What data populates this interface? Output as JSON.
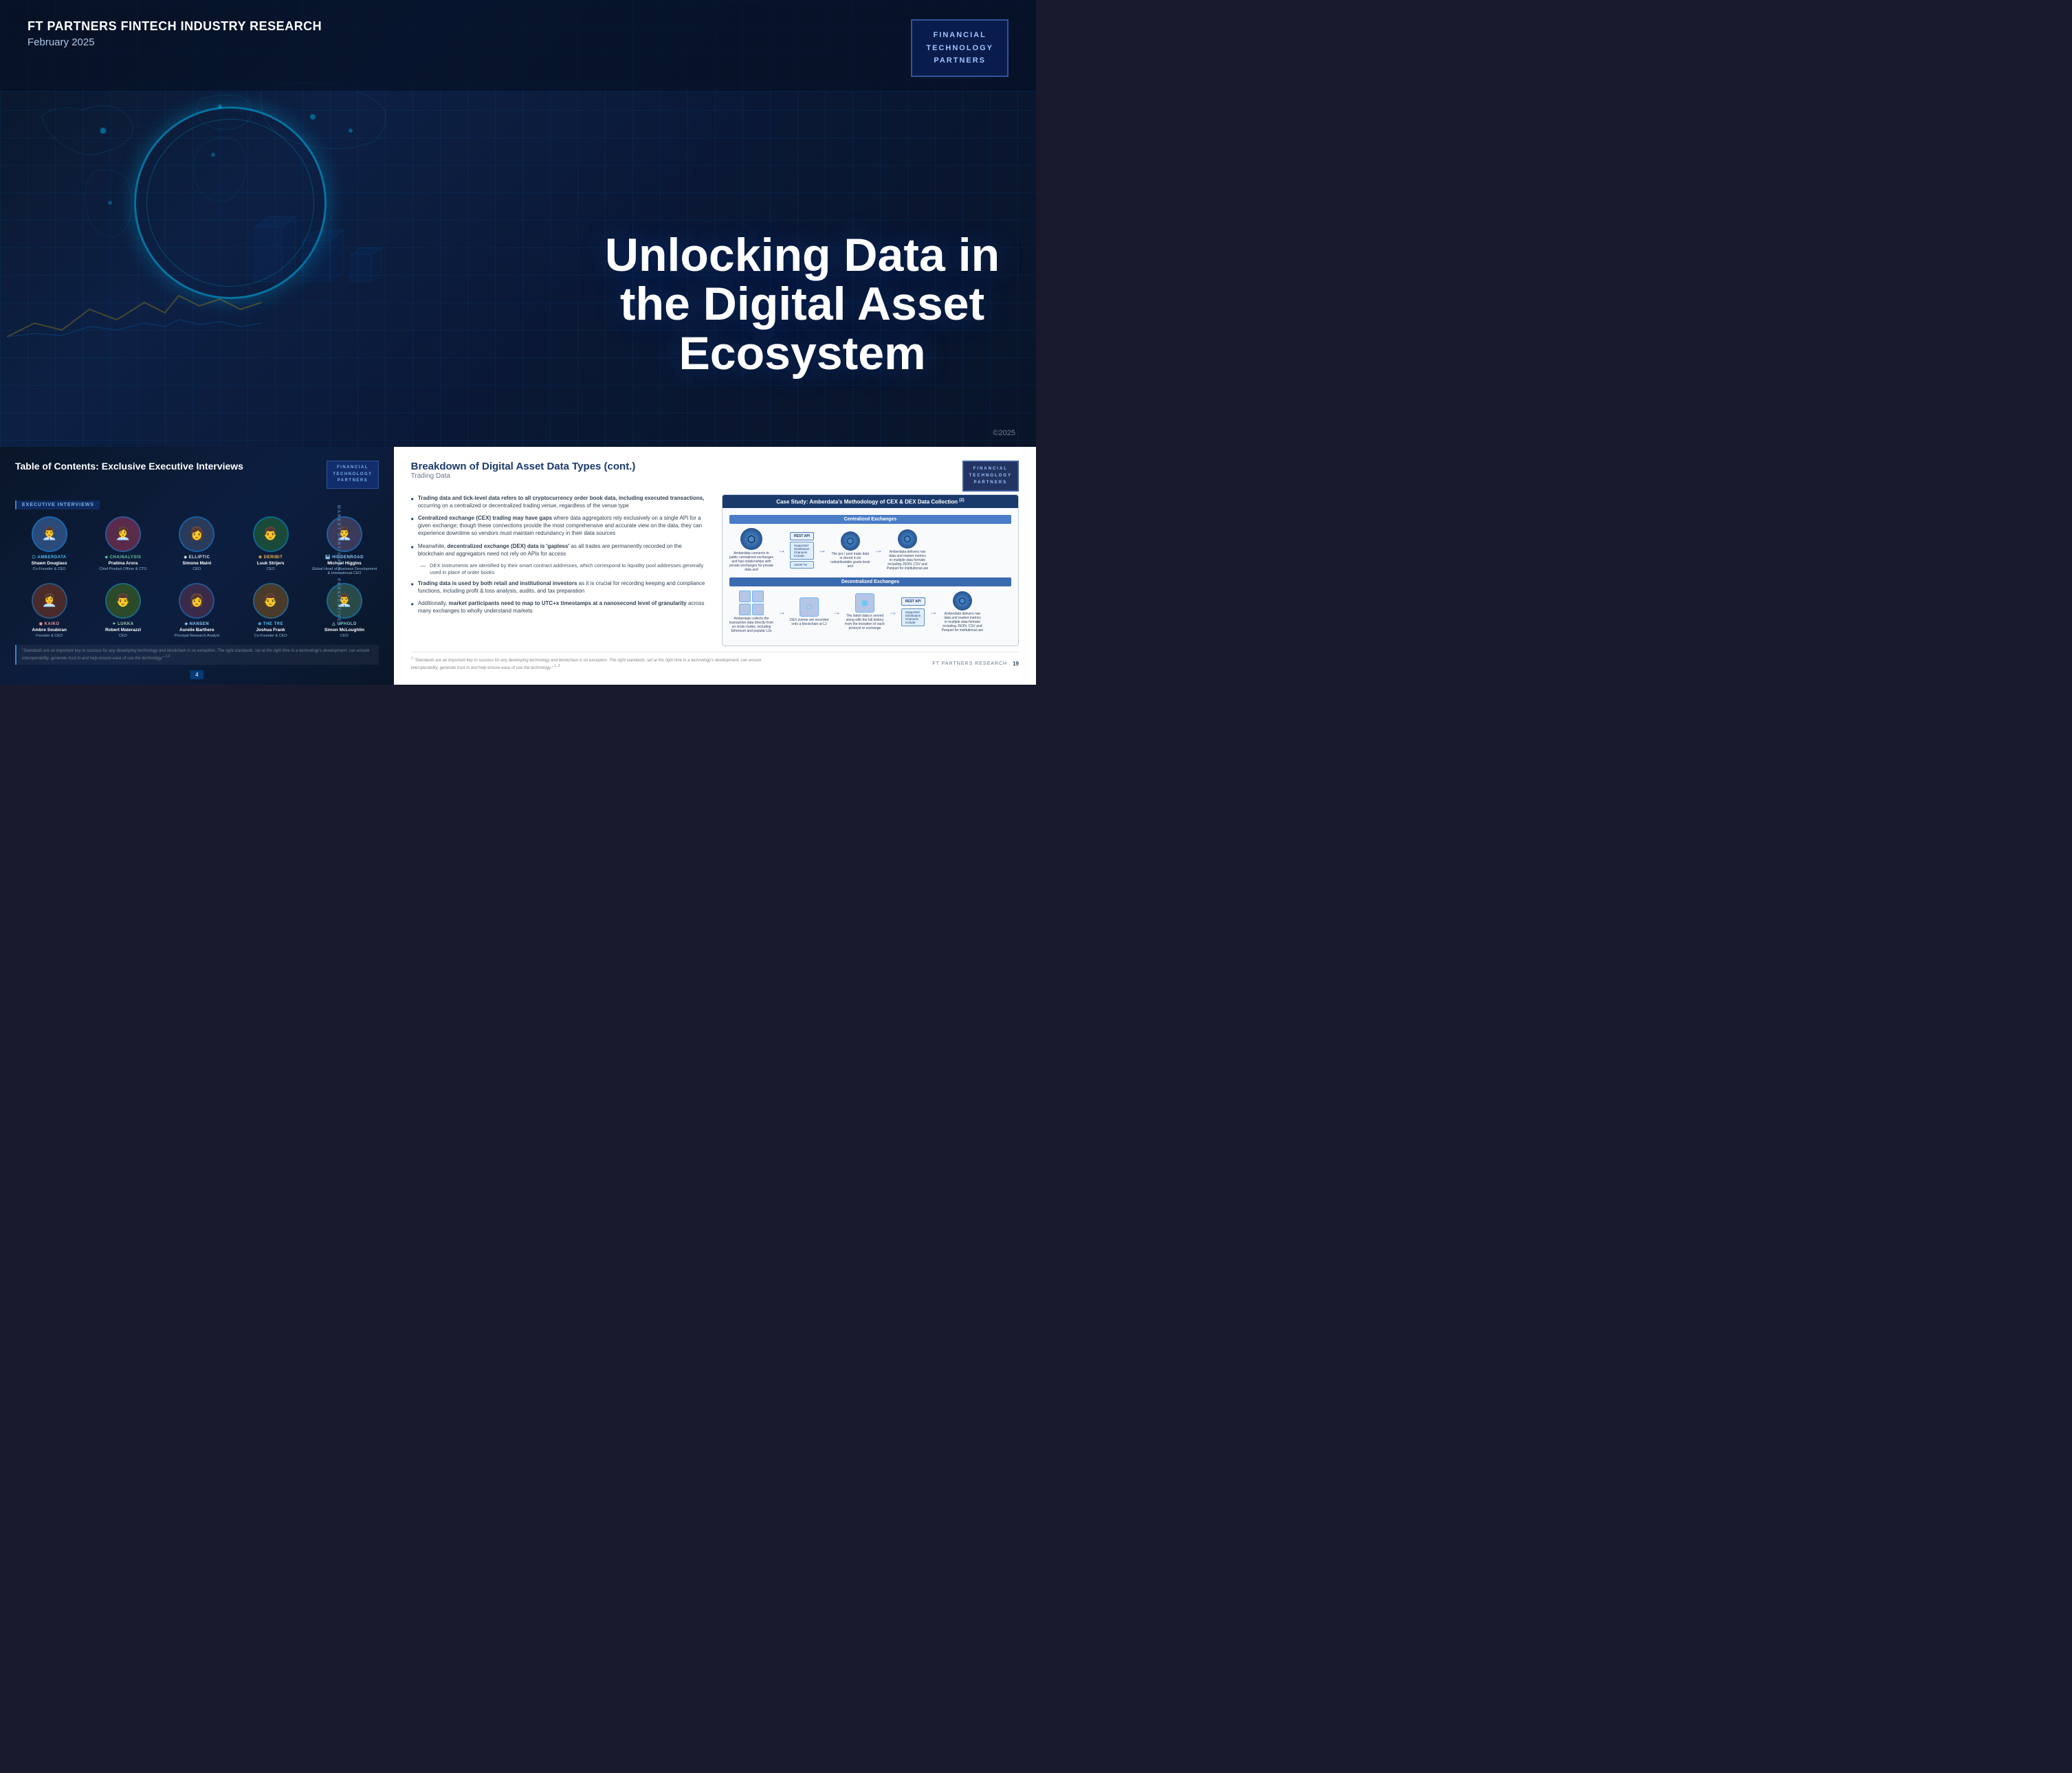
{
  "header": {
    "title": "FT PARTNERS FINTECH INDUSTRY RESEARCH",
    "date": "February 2025",
    "copyright": "©2025"
  },
  "logo": {
    "line1": "FINANCIAL",
    "line2": "TECHNOLOGY",
    "line3": "PARTNERS"
  },
  "hero": {
    "headline_line1": "Unlocking Data in",
    "headline_line2": "the Digital Asset",
    "headline_line3": "Ecosystem"
  },
  "toc": {
    "title": "Table of Contents: Exclusive Executive Interviews",
    "section_label": "Executive Interviews",
    "side_label": "Market Participant Perspectives",
    "page_number": "4",
    "quote": "\"Standards are an important key to success for any developing technology and blockchain is no exception. The right standards, set at the right time in a technology's development, can ensure interoperability, generate trust in and help ensure ease of use the technology.\"",
    "logo_line1": "FINANCIAL",
    "logo_line2": "TECHNOLOGY",
    "logo_line3": "PARTNERS",
    "people": [
      {
        "company": "amberdata",
        "name": "Shawn Douglass",
        "title": "Co-Founder & CEO",
        "emoji": "👨‍💼",
        "avatar_class": "avatar-shawn",
        "company_class": "company-amberdata"
      },
      {
        "company": "Chainalysis",
        "name": "Pratima Arora",
        "title": "Chief Product Officer & CTO",
        "emoji": "👩‍💼",
        "avatar_class": "avatar-pratima",
        "company_class": "company-chainalysis"
      },
      {
        "company": "ELLIPTIC",
        "name": "Simone Maini",
        "title": "CEO",
        "emoji": "👩",
        "avatar_class": "avatar-simone",
        "company_class": "company-elliptic"
      },
      {
        "company": "Deribit",
        "name": "Luuk Strijers",
        "title": "CEO",
        "emoji": "👨",
        "avatar_class": "avatar-luuk",
        "company_class": "company-deribit"
      },
      {
        "company": "HiddenRoad",
        "name": "Michael Higgins",
        "title": "Global Head of Business Development & International CEO",
        "emoji": "👨‍💼",
        "avatar_class": "avatar-michael",
        "company_class": "company-hiddenroad"
      },
      {
        "company": "Kaiko",
        "name": "Ambre Soubiran",
        "title": "Founder & CEO",
        "emoji": "👩‍💼",
        "avatar_class": "avatar-ambre",
        "company_class": "company-kaiko"
      },
      {
        "company": "Lukka",
        "name": "Robert Materazzi",
        "title": "CEO",
        "emoji": "👨",
        "avatar_class": "avatar-robert",
        "company_class": "company-lukka"
      },
      {
        "company": "nansen",
        "name": "Aurelie Barthere",
        "title": "Principal Research Analyst",
        "emoji": "👩",
        "avatar_class": "avatar-aurelie",
        "company_class": "company-nansen"
      },
      {
        "company": "The Tre",
        "name": "Joshua Frank",
        "title": "Co-Founder & CEO",
        "emoji": "👨",
        "avatar_class": "avatar-joshua",
        "company_class": "company-thetre"
      },
      {
        "company": "uphold",
        "name": "Simon McLoughlin",
        "title": "CEO",
        "emoji": "👨‍💼",
        "avatar_class": "avatar-simon",
        "company_class": "company-uphold"
      }
    ]
  },
  "breakdown": {
    "title": "Breakdown of Digital Asset Data Types (cont.)",
    "subtitle": "Trading Data",
    "case_study_title": "Case Study: Amberdata's Methodology of CEX & DEX Data Collection",
    "case_study_footnote": "2",
    "bullets": [
      {
        "text": "Trading data and tick-level data refers to all cryptocurrency order book data, including executed transactions, occurring on a centralized or decentralized trading venue, regardless of the venue type",
        "bold_start": "Trading data and tick-level data refers to all cryptocurrency order book data, including executed transactions,"
      },
      {
        "text": "Centralized exchange (CEX) trading may have gaps where data aggregators rely exclusively on a single API for a given exchange; though these connections provide the most comprehensive and accurate view on the data, they can experience downtime so vendors must maintain redundancy in their data sources",
        "bold_start": "Centralized exchange (CEX) trading may have gaps"
      },
      {
        "text": "Meanwhile, decentralized exchange (DEX) data is 'gapless' as all trades are permanently recorded on the blockchain and aggregators need not rely on APIs for access",
        "bold_start": "decentralized exchange (DEX) data is 'gapless'"
      },
      {
        "sub_bullets": [
          "DEX instruments are identified by their smart contract addresses, which correspond to liquidity pool addresses generally used in place of order books"
        ]
      },
      {
        "text": "Trading data is used by both retail and institutional investors as it is crucial for recording keeping and compliance functions, including profit & loss analysis, audits, and tax preparation",
        "bold_start": "Trading data is used by both retail and institutional investors"
      },
      {
        "text": "Additionally, market participants need to map to UTC+x timestamps at a nanosecond level of granularity across many exchanges to wholly understand markets",
        "bold_start": "market participants need to map to UTC+x timestamps at a nanosecond level of granularity"
      }
    ],
    "cex_section": {
      "title": "Centralized Exchanges",
      "desc1": "Amberdata connects to public centralized exchanges and has relationships with private exchanges for private data",
      "desc2": "The pre / post trade data is stored in its redistributable grade book and",
      "desc3": "Amberdata delivers raw data and market metrics in multiple data formats including JSON, CSV and Parquet for institutional use"
    },
    "dex_section": {
      "title": "Decentralized Exchanges",
      "desc1": "Amberdata collects the transaction data directly from on-chain nodes, including Ethereum and popular L2s",
      "desc2": "DEX events are recorded onto a blockchain at L2",
      "desc3": "The latest data is served along with the full history from the inception of each protocol or exchange",
      "desc4": "Amberdata delivers raw data and market metrics in multiple data formats including JSON, CSV and Parquet for institutional use"
    },
    "footer_text": "FT PARTNERS RESEARCH",
    "footer_page": "19",
    "footnote": "\"Standards are an important key to success for any developing technology and blockchain is no exception. The right standards, set at the right time in a technology's development, can ensure interoperability, generate trust in and help ensure ease of use the technology.\""
  }
}
